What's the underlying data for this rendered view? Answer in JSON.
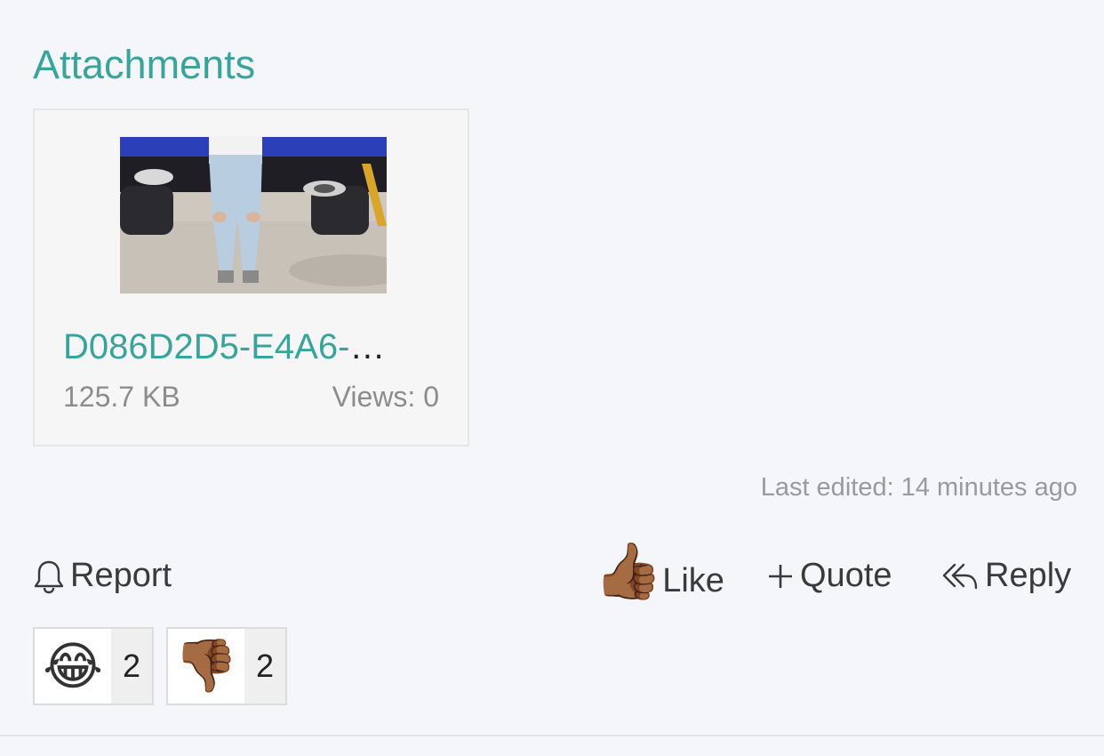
{
  "attachments": {
    "title": "Attachments",
    "file": {
      "name": "D086D2D5-E4A6-",
      "ellipsis": "…",
      "size": "125.7 KB",
      "views": "Views: 0"
    }
  },
  "post": {
    "last_edited": "Last edited: 14 minutes ago"
  },
  "actions": {
    "report": "Report",
    "like": "Like",
    "like_emoji": "👍🏾",
    "quote": "Quote",
    "reply": "Reply"
  },
  "reactions": [
    {
      "emoji": "😂",
      "icon": "tears-of-joy-emoji",
      "count": "2"
    },
    {
      "emoji": "👎🏾",
      "icon": "thumbs-down-emoji",
      "count": "2"
    }
  ],
  "colors": {
    "accent": "#3aa49a",
    "background": "#f5f6fa",
    "muted_text": "#8c8c8c"
  }
}
